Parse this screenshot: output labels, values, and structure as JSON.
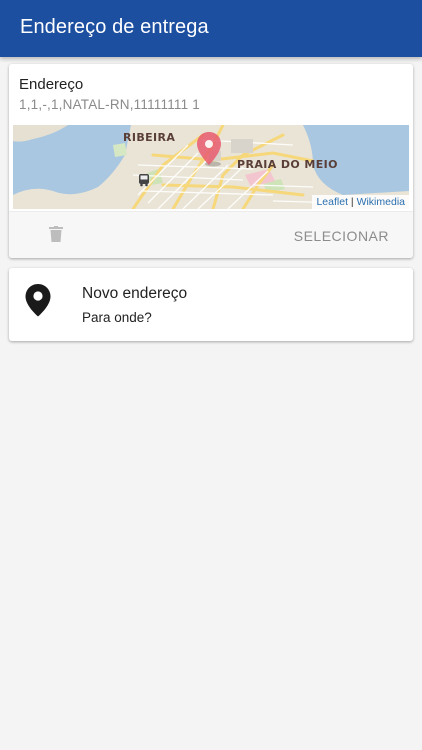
{
  "header": {
    "title": "Endereço de entrega"
  },
  "address_card": {
    "title": "Endereço",
    "address": "1,1,-,1,NATAL-RN,11111111 1",
    "map": {
      "labels": {
        "ribeira": "RIBEIRA",
        "praia_do_meio": "PRAIA DO MEIO"
      },
      "attribution": {
        "leaflet": "Leaflet",
        "separator": " | ",
        "wikimedia": "Wikimedia"
      },
      "marker_icon": "map-marker-icon",
      "bus_icon": "bus-icon"
    },
    "actions": {
      "delete_icon": "trash-icon",
      "select_label": "SELECIONAR"
    }
  },
  "new_address_card": {
    "icon": "location-pin-icon",
    "title": "Novo endereço",
    "subtitle": "Para onde?"
  },
  "colors": {
    "appbar": "#1c4fa0",
    "background": "#f4f4f4",
    "marker": "#e85a6e"
  }
}
